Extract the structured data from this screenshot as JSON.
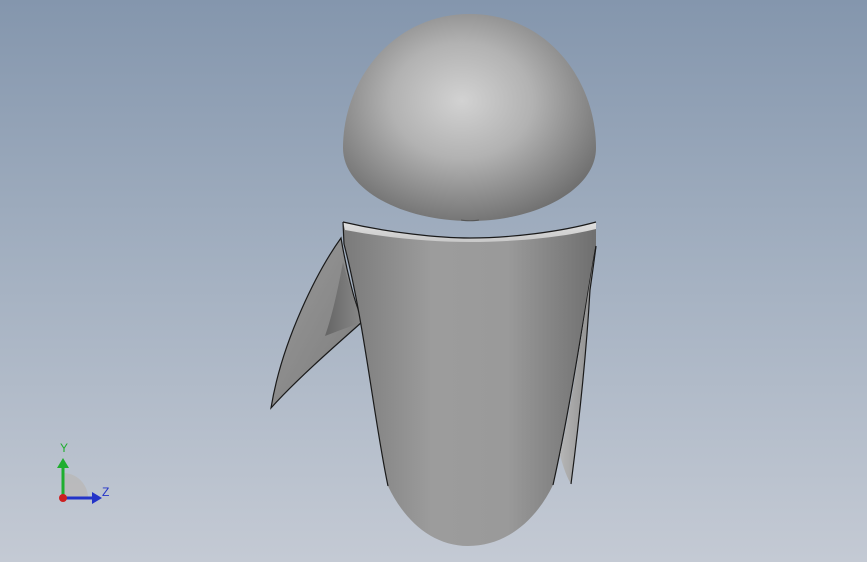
{
  "viewport": {
    "background_top": "#8496ad",
    "background_bottom": "#c4cad4"
  },
  "model": {
    "parts": [
      "head-dome",
      "body-shell",
      "left-arm",
      "right-arm"
    ],
    "surface_color": "#a4a4a4",
    "edge_color": "#1a1a1a"
  },
  "triad": {
    "y_label": "Y",
    "z_label": "Z",
    "y_color": "#1fae2e",
    "z_color": "#2333c8",
    "origin_color": "#cc1f1f"
  }
}
